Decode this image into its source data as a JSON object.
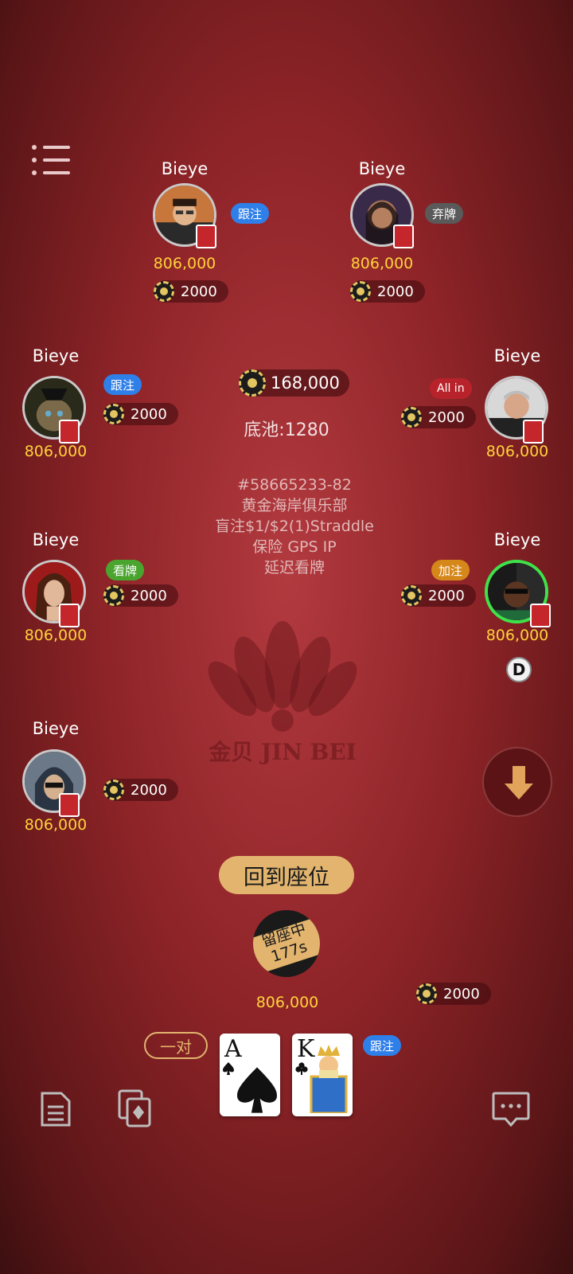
{
  "table": {
    "pot_total": "168,000",
    "pot_label": "底池:1280",
    "game_id": "#58665233-82",
    "club_name": "黄金海岸俱乐部",
    "blinds": "盲注$1/$2(1)Straddle",
    "features": "保险 GPS IP",
    "delay": "延迟看牌",
    "watermark": "金贝 JIN BEI"
  },
  "players": [
    {
      "name": "Bieye",
      "stack": "806,000",
      "bet": "2000",
      "action": "跟注",
      "action_color": "#2f7fe8"
    },
    {
      "name": "Bieye",
      "stack": "806,000",
      "bet": "2000",
      "action": "弃牌",
      "action_color": "#5a5a5a"
    },
    {
      "name": "Bieye",
      "stack": "806,000",
      "bet": "2000",
      "action": "跟注",
      "action_color": "#2f7fe8"
    },
    {
      "name": "Bieye",
      "stack": "806,000",
      "bet": "2000",
      "action": "All in",
      "action_color": "#b8232b"
    },
    {
      "name": "Bieye",
      "stack": "806,000",
      "bet": "2000",
      "action": "看牌",
      "action_color": "#4aa52f"
    },
    {
      "name": "Bieye",
      "stack": "806,000",
      "bet": "2000",
      "action": "加注",
      "action_color": "#d6871a"
    },
    {
      "name": "Bieye",
      "stack": "806,000",
      "bet": "2000",
      "action": "",
      "action_color": ""
    }
  ],
  "dealer_button": "D",
  "hero": {
    "return_seat_label": "回到座位",
    "timer_line1": "留座中",
    "timer_line2": "177s",
    "stack": "806,000",
    "bet": "2000",
    "hand_type": "一对",
    "last_action": "跟注",
    "cards": [
      {
        "rank": "A",
        "suit": "spades"
      },
      {
        "rank": "K",
        "suit": "clubs"
      }
    ]
  },
  "icons": {
    "menu": "menu-icon",
    "scroll_down": "arrow-down-icon",
    "history": "document-icon",
    "cards_review": "cards-icon",
    "chat": "chat-icon"
  }
}
